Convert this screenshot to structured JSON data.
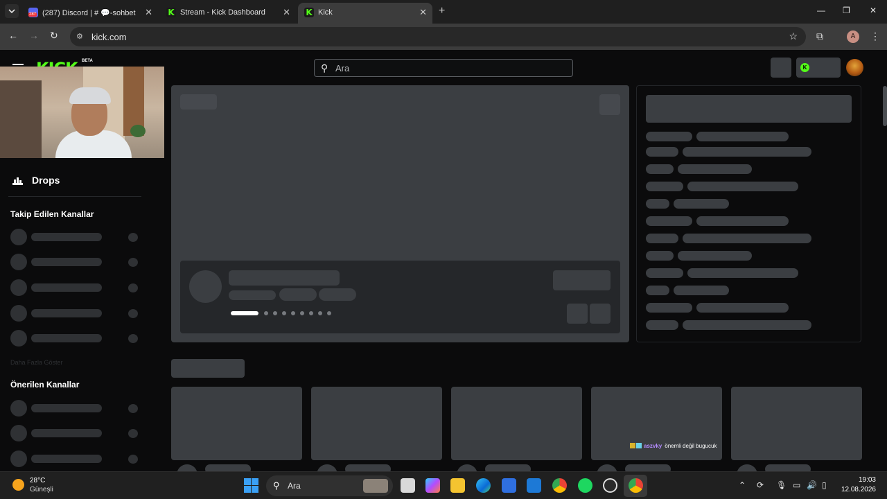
{
  "browser": {
    "tabs": [
      {
        "title": "(287) Discord | # 💬-sohbet",
        "close": "✕"
      },
      {
        "title": "Stream - Kick Dashboard",
        "close": "✕"
      },
      {
        "title": "Kick",
        "close": "✕"
      }
    ],
    "new_tab": "+",
    "window_controls": {
      "minimize": "—",
      "restore": "❐",
      "close": "✕"
    },
    "nav": {
      "back": "←",
      "forward": "→",
      "reload": "↻"
    },
    "url": "kick.com",
    "bookmark_icon": "star-icon",
    "profile_initial": "A"
  },
  "page": {
    "logo": "KICK",
    "beta": "BETA",
    "search_placeholder": "Ara",
    "sidebar": {
      "drops_label": "Drops",
      "followed_heading": "Takip Edilen Kanallar",
      "show_more": "Daha Fazla Göster",
      "recommended_heading": "Önerilen Kanallar"
    },
    "overlay": {
      "username": "aszvky",
      "message": "önemli değil bugucuk"
    }
  },
  "taskbar": {
    "temperature": "28°C",
    "condition": "Güneşli",
    "search_placeholder": "Ara",
    "time": "19:03",
    "date": "12.08.2026"
  }
}
